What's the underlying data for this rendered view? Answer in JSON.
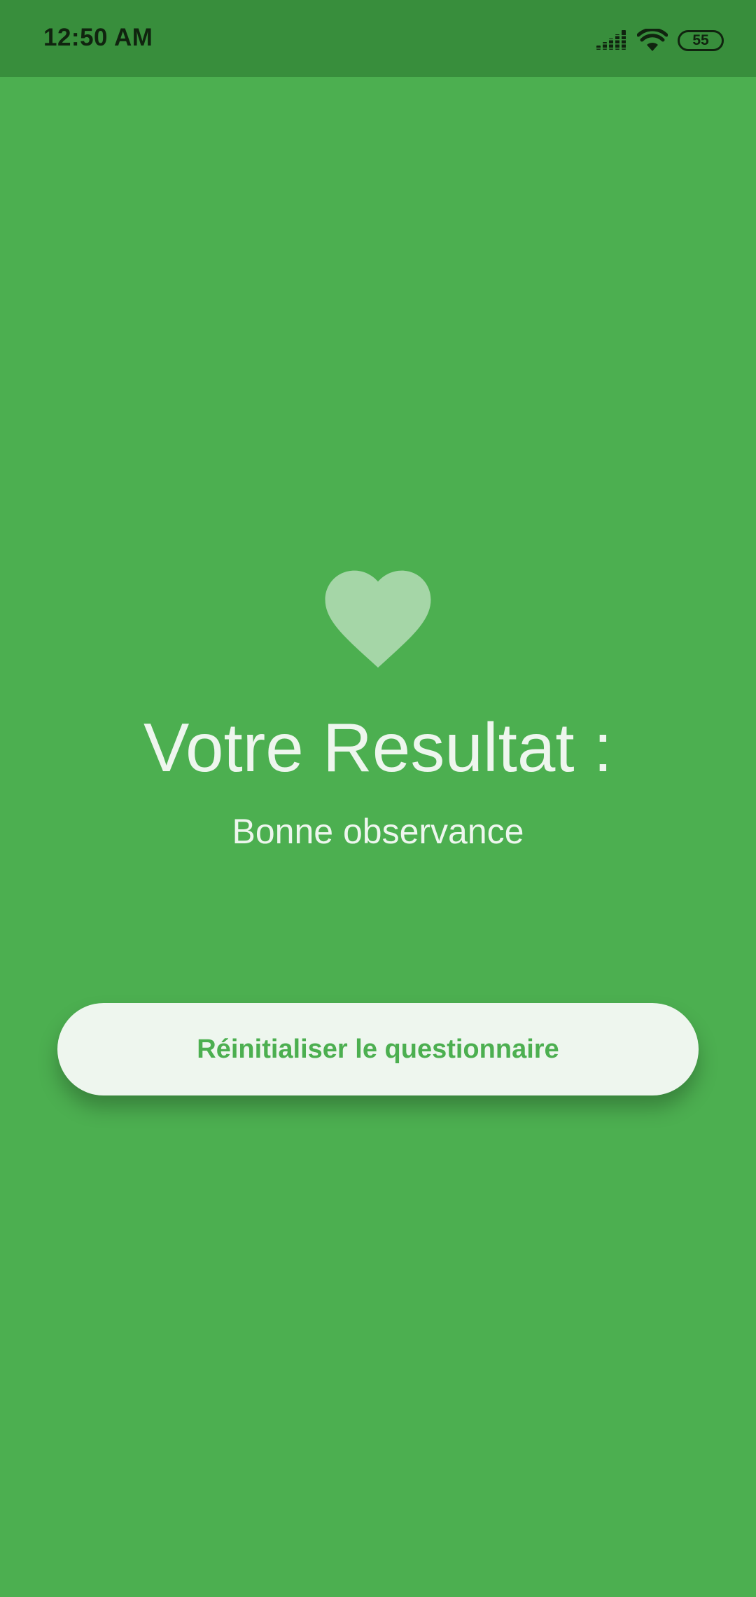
{
  "status_bar": {
    "time": "12:50 AM",
    "battery": "55",
    "signal_icon": "signal-icon",
    "wifi_icon": "wifi-icon"
  },
  "result": {
    "icon": "heart-icon",
    "title": "Votre Resultat :",
    "value": "Bonne observance"
  },
  "actions": {
    "reset_label": "Réinitialiser le questionnaire"
  },
  "colors": {
    "background": "#4caf50",
    "status_bar": "#388e3c",
    "heart": "#a5d6a7",
    "button_bg": "#eef6ee",
    "button_text": "#4caf50"
  }
}
